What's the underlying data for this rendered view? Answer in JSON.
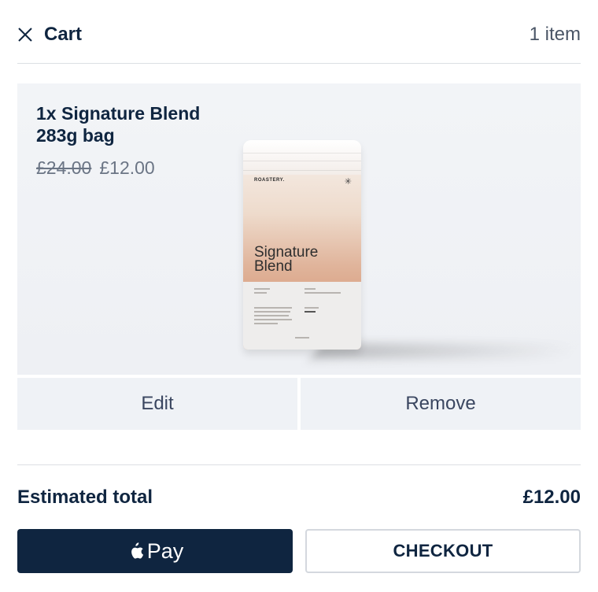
{
  "header": {
    "title": "Cart",
    "item_count": "1 item"
  },
  "product": {
    "name": "1x Signature Blend 283g bag",
    "price_original": "£24.00",
    "price_sale": "£12.00",
    "bag": {
      "brand": "ROASTERY.",
      "title": "Signature Blend"
    }
  },
  "actions": {
    "edit_label": "Edit",
    "remove_label": "Remove"
  },
  "summary": {
    "total_label": "Estimated total",
    "total_value": "£12.00"
  },
  "payment": {
    "apple_pay_label": "Pay",
    "checkout_label": "CHECKOUT"
  },
  "colors": {
    "primary": "#0f2540",
    "action_bg": "#eff2f6",
    "divider": "#dcdfe4"
  },
  "icons": [
    "close-icon",
    "apple-icon",
    "asterisk-icon"
  ]
}
